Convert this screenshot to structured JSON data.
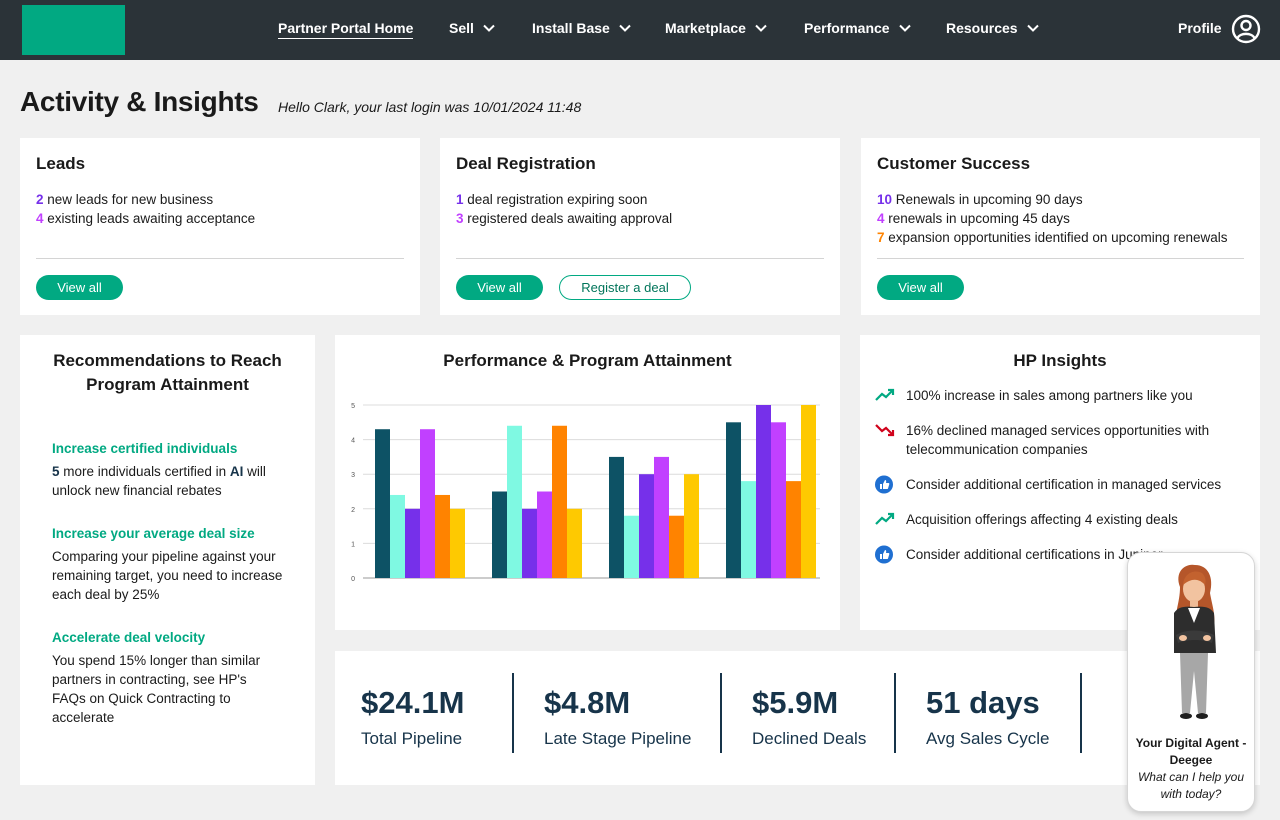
{
  "nav": {
    "items": [
      {
        "label": "Partner Portal Home"
      },
      {
        "label": "Sell"
      },
      {
        "label": "Install Base"
      },
      {
        "label": "Marketplace"
      },
      {
        "label": "Performance"
      },
      {
        "label": "Resources"
      }
    ],
    "profile_label": "Profile"
  },
  "header": {
    "title": "Activity & Insights",
    "login_text": "Hello Clark, your last login was 10/01/2024 11:48"
  },
  "leads": {
    "title": "Leads",
    "lines": [
      {
        "num": "2",
        "text": " new leads for new business"
      },
      {
        "num": "4",
        "text": " existing leads awaiting acceptance"
      }
    ],
    "view_all": "View all"
  },
  "deals": {
    "title": "Deal Registration",
    "lines": [
      {
        "num": "1",
        "text": " deal registration expiring soon"
      },
      {
        "num": "3",
        "text": " registered deals awaiting approval"
      }
    ],
    "view_all": "View all",
    "register": "Register a deal"
  },
  "success": {
    "title": "Customer Success",
    "lines": [
      {
        "num": "10",
        "text": " Renewals in upcoming 90 days"
      },
      {
        "num": "4",
        "text": " renewals in upcoming 45 days"
      },
      {
        "num": "7",
        "text": " expansion opportunities identified on upcoming renewals"
      }
    ],
    "view_all": "View all"
  },
  "recommendations": {
    "title": "Recommendations to Reach Program Attainment",
    "items": [
      {
        "head": "Increase certified individuals",
        "num": "5",
        "pre": " more individuals certified in ",
        "bold": "AI",
        "post": " will unlock new financial rebates"
      },
      {
        "head": "Increase your average deal size",
        "body": "Comparing your pipeline against your remaining target, you need to increase each deal by 25%"
      },
      {
        "head": "Accelerate deal velocity",
        "body": "You spend 15% longer than similar partners in contracting, see HP's FAQs on Quick Contracting to accelerate"
      }
    ]
  },
  "chart_data": {
    "type": "bar",
    "title": "Performance & Program Attainment",
    "xlabel": "",
    "ylabel": "",
    "ylim": [
      0,
      5
    ],
    "yticks": [
      "0",
      "1",
      "2",
      "3",
      "4",
      "5"
    ],
    "grid": true,
    "legend": "none",
    "groups": 4,
    "series": [
      {
        "color": "#0d5265",
        "values": [
          4.3,
          2.5,
          3.5,
          4.5
        ]
      },
      {
        "color": "#7ff9e2",
        "values": [
          2.4,
          4.4,
          1.8,
          2.8
        ]
      },
      {
        "color": "#7630ea",
        "values": [
          2.0,
          2.0,
          3.0,
          5.0
        ]
      },
      {
        "color": "#c140ff",
        "values": [
          4.3,
          2.5,
          3.5,
          4.5
        ]
      },
      {
        "color": "#ff8300",
        "values": [
          2.4,
          4.4,
          1.8,
          2.8
        ]
      },
      {
        "color": "#fec901",
        "values": [
          2.0,
          2.0,
          3.0,
          5.0
        ]
      }
    ]
  },
  "insights": {
    "title": "HP Insights",
    "items": [
      {
        "icon": "trend-up-icon",
        "text": "100% increase in sales among partners like you"
      },
      {
        "icon": "trend-down-icon",
        "text": "16% declined managed services opportunities with telecommunication companies"
      },
      {
        "icon": "thumbs-up-icon",
        "text": "Consider additional certification in managed services"
      },
      {
        "icon": "trend-up-icon",
        "text": "Acquisition offerings affecting 4 existing deals"
      },
      {
        "icon": "thumbs-up-icon",
        "text": "Consider additional certifications in Juniper"
      }
    ]
  },
  "stats": [
    {
      "value": "$24.1M",
      "label": "Total Pipeline"
    },
    {
      "value": "$4.8M",
      "label": "Late Stage Pipeline"
    },
    {
      "value": "$5.9M",
      "label": "Declined Deals"
    },
    {
      "value": "51 days",
      "label": "Avg Sales Cycle"
    }
  ],
  "agent": {
    "name": "Your Digital Agent - Deegee",
    "prompt": "What can I help you with today?"
  },
  "colors": {
    "nav_bg": "#2b3338",
    "brand_green": "#01a982",
    "navy": "#17344a"
  }
}
